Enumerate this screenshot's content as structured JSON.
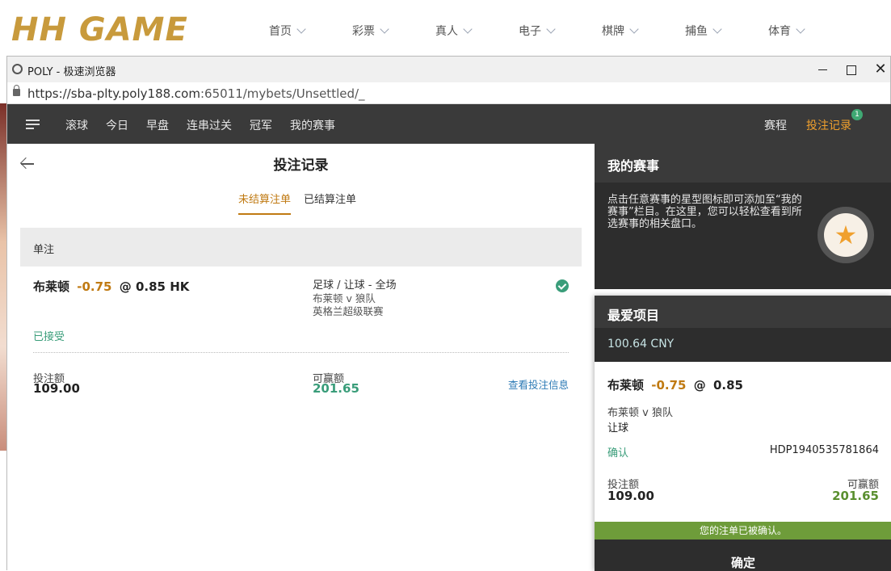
{
  "site": {
    "logo_text": "HH GAME",
    "nav": [
      {
        "label": "首页"
      },
      {
        "label": "彩票"
      },
      {
        "label": "真人"
      },
      {
        "label": "电子"
      },
      {
        "label": "棋牌"
      },
      {
        "label": "捕鱼"
      },
      {
        "label": "体育"
      }
    ]
  },
  "window": {
    "title": "POLY - 极速浏览器",
    "close_glyph": "✕"
  },
  "address": {
    "url_main": "https://sba-plty.poly188.com",
    "url_rest": ":65011/mybets/Unsettled/_"
  },
  "topnav": {
    "items": [
      "滚球",
      "今日",
      "早盘",
      "连串过关",
      "冠军",
      "我的赛事"
    ],
    "schedule": "赛程",
    "bet_records": "投注记录",
    "badge_count": "1",
    "active_color": "#f0a02d"
  },
  "records": {
    "title": "投注记录",
    "tabs": [
      "未结算注单",
      "已结算注单"
    ],
    "section": "单注",
    "bet": {
      "team": "布莱顿",
      "handicap": "-0.75",
      "at": "@",
      "odds": "0.85 HK",
      "market": "足球 / 让球 - 全场",
      "match": "布莱顿 v 狼队",
      "league": "英格兰超级联赛",
      "status": "已接受",
      "stake_label": "投注额",
      "stake": "109.00",
      "win_label": "可赢额",
      "win": "201.65",
      "detail_link": "查看投注信息"
    }
  },
  "my_events": {
    "title": "我的赛事",
    "text": "点击任意赛事的星型图标即可添加至“我的赛事”栏目。在这里，您可以轻松查看到所选赛事的相关盘口。",
    "star": "★"
  },
  "slip": {
    "title": "最爱项目",
    "balance": "100.64 CNY",
    "team": "布莱顿",
    "handicap": "-0.75",
    "at": "@",
    "odds": "0.85",
    "match": "布莱顿 v 狼队",
    "market": "让球",
    "confirm_label": "确认",
    "ref": "HDP1940535781864",
    "stake_label": "投注额",
    "stake": "109.00",
    "win_label": "可赢额",
    "win": "201.65",
    "status": "您的注单已被确认。",
    "ok": "确定"
  }
}
